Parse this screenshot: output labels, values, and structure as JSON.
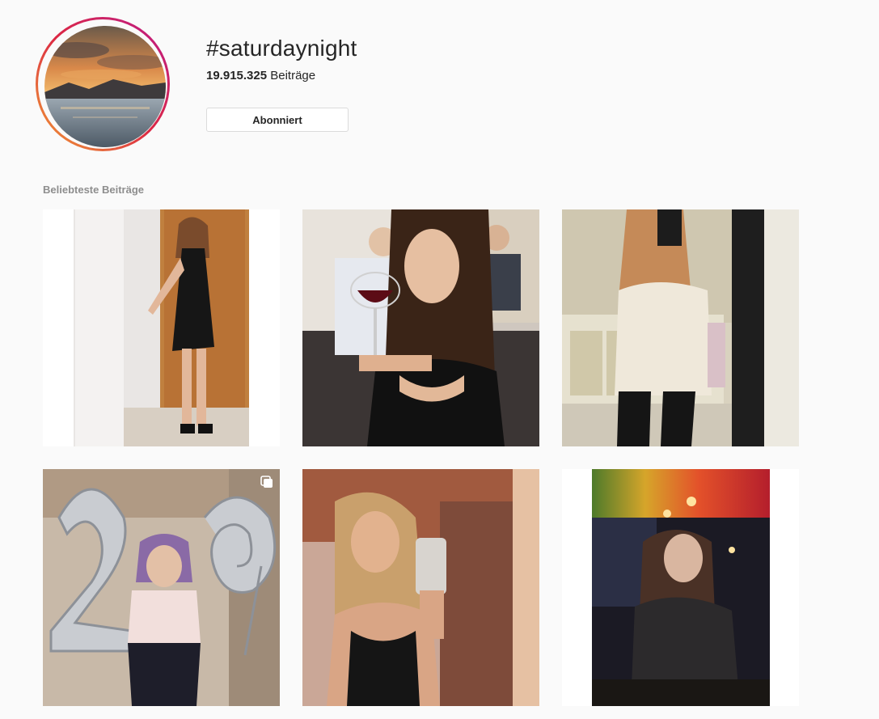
{
  "header": {
    "hashtag": "#saturdaynight",
    "post_count": "19.915.325",
    "post_count_label": "Beiträge",
    "follow_button_label": "Abonniert"
  },
  "section": {
    "label": "Beliebteste Beiträge"
  },
  "posts": [
    {
      "multiple": true
    },
    {
      "multiple": false
    },
    {
      "multiple": false
    },
    {
      "multiple": true
    },
    {
      "multiple": false
    },
    {
      "multiple": false
    }
  ],
  "colors": {
    "background": "#fafafa",
    "text": "#262626",
    "muted": "#8e8e8e",
    "border": "#dbdbdb",
    "ring_start": "#f09433",
    "ring_end": "#bc1888"
  },
  "icons": {
    "multi_post": "carousel-icon"
  }
}
